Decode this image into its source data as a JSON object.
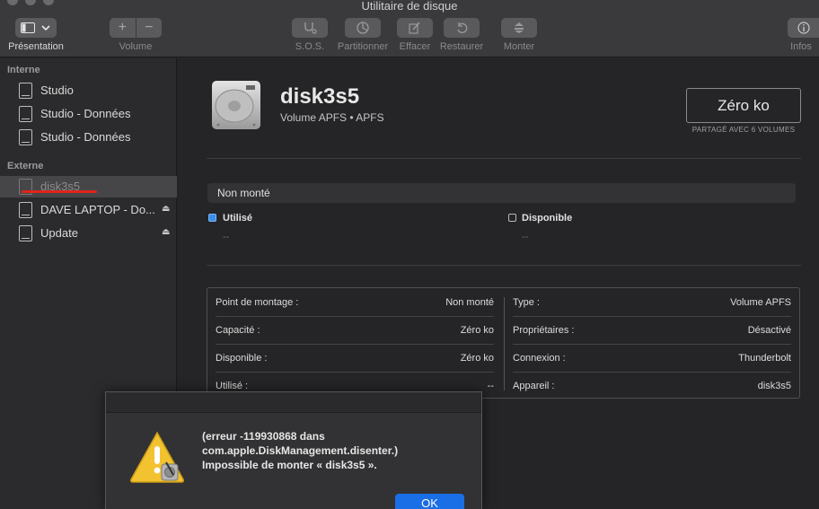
{
  "window": {
    "title": "Utilitaire de disque"
  },
  "toolbar": {
    "view_label": "Présentation",
    "volume_label": "Volume",
    "volume_add": "+",
    "volume_remove": "−",
    "sos_label": "S.O.S.",
    "partition_label": "Partitionner",
    "erase_label": "Effacer",
    "restore_label": "Restaurer",
    "mount_label": "Monter",
    "info_label": "Infos"
  },
  "sidebar": {
    "internal_header": "Interne",
    "external_header": "Externe",
    "internal_items": [
      {
        "label": "Studio"
      },
      {
        "label": "Studio - Données"
      },
      {
        "label": "Studio - Données"
      }
    ],
    "external_items": [
      {
        "label": "disk3s5",
        "selected": true
      },
      {
        "label": "DAVE LAPTOP - Do...",
        "eject": "⏏"
      },
      {
        "label": "Update",
        "eject": "⏏"
      }
    ]
  },
  "volume": {
    "name": "disk3s5",
    "subtitle": "Volume APFS • APFS",
    "size": "Zéro ko",
    "shared": "PARTAGÉ AVEC 6 VOLUMES",
    "status": "Non monté",
    "used_label": "Utilisé",
    "used_value": "--",
    "available_label": "Disponible",
    "available_value": "--"
  },
  "details": {
    "left": [
      {
        "key": "Point de montage :",
        "value": "Non monté"
      },
      {
        "key": "Capacité :",
        "value": "Zéro ko"
      },
      {
        "key": "Disponible :",
        "value": "Zéro ko"
      },
      {
        "key": "Utilisé :",
        "value": "--"
      }
    ],
    "right": [
      {
        "key": "Type :",
        "value": "Volume APFS"
      },
      {
        "key": "Propriétaires :",
        "value": "Désactivé"
      },
      {
        "key": "Connexion :",
        "value": "Thunderbolt"
      },
      {
        "key": "Appareil :",
        "value": "disk3s5"
      }
    ]
  },
  "alert": {
    "message_line1": "(erreur -119930868 dans",
    "message_line2": "com.apple.DiskManagement.disenter.)",
    "message_line3": "Impossible de monter « disk3s5 ».",
    "ok_label": "OK"
  },
  "colors": {
    "accent": "#1a6ee6",
    "used_dot": "#3b8ee8",
    "highlight_mark": "#e0241c"
  }
}
